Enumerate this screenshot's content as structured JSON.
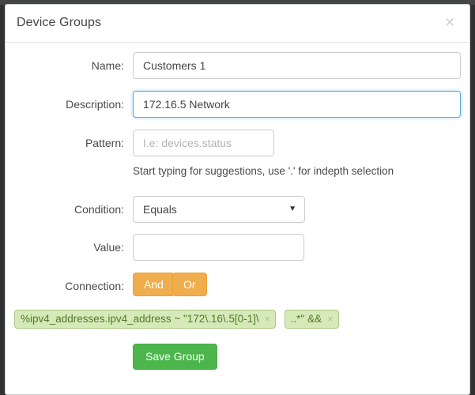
{
  "modal": {
    "title": "Device Groups",
    "close_icon": "close-icon",
    "close_glyph": "×"
  },
  "form": {
    "name": {
      "label": "Name:",
      "value": "Customers 1",
      "placeholder": ""
    },
    "description": {
      "label": "Description:",
      "value": "172.16.5 Network",
      "placeholder": "",
      "focused": true
    },
    "pattern": {
      "label": "Pattern:",
      "value": "",
      "placeholder": "I.e: devices.status",
      "help": "Start typing for suggestions, use '.' for indepth selection"
    },
    "condition": {
      "label": "Condition:",
      "selected": "Equals",
      "caret_glyph": "▼",
      "options": [
        "Equals"
      ]
    },
    "value": {
      "label": "Value:",
      "value": "",
      "placeholder": ""
    },
    "connection": {
      "label": "Connection:",
      "buttons": [
        {
          "label": "And"
        },
        {
          "label": "Or"
        }
      ]
    }
  },
  "chips": [
    {
      "text": "%ipv4_addresses.ipv4_address ~ \"172\\.16\\.5[0-1]\\",
      "remove_glyph": "×"
    },
    {
      "text": "..*\" &&",
      "remove_glyph": "×"
    }
  ],
  "actions": {
    "save_label": "Save Group"
  },
  "colors": {
    "accent_blue": "#5aa9e6",
    "warning_orange": "#f0ad4e",
    "success_green": "#4cb64c",
    "chip_green_bg": "#d7e9b9",
    "chip_green_border": "#a8c97f",
    "chip_text": "#4f7a2a",
    "backdrop": "#2f3133"
  }
}
